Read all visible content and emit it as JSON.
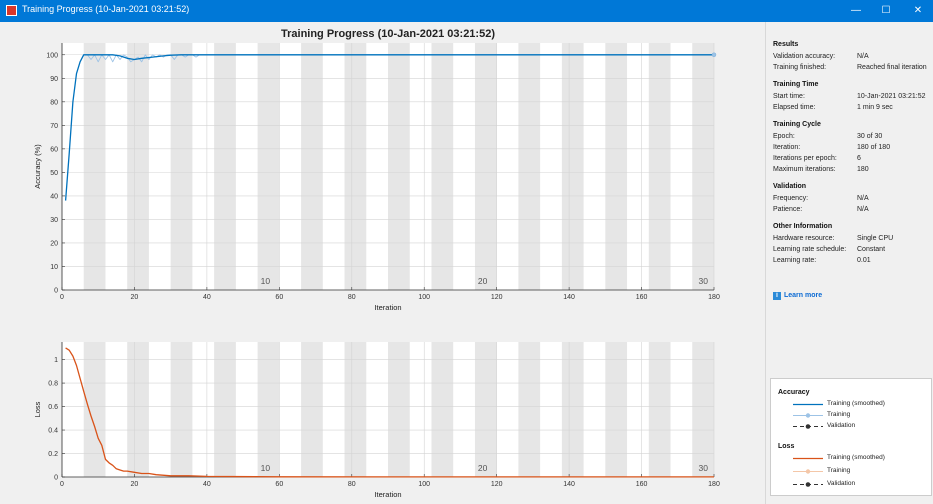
{
  "window": {
    "title": "Training Progress (10-Jan-2021 03:21:52)",
    "controls": {
      "minimize": "—",
      "maximize": "☐",
      "close": "✕"
    }
  },
  "plot_title": "Training Progress (10-Jan-2021 03:21:52)",
  "chart_data": [
    {
      "type": "line",
      "title": "Training Progress (10-Jan-2021 03:21:52)",
      "xlabel": "Iteration",
      "ylabel": "Accuracy (%)",
      "xlim": [
        0,
        180
      ],
      "ylim": [
        0,
        105
      ],
      "xticks": [
        0,
        20,
        40,
        60,
        80,
        100,
        120,
        140,
        160,
        180
      ],
      "yticks": [
        0,
        10,
        20,
        30,
        40,
        50,
        60,
        70,
        80,
        90,
        100
      ],
      "epoch_labels": [
        "10",
        "20",
        "30"
      ],
      "epoch_label_positions": [
        60,
        120,
        180
      ],
      "grid": true,
      "epoch_bands": {
        "iterations_per_epoch": 6,
        "shaded": "alternate"
      },
      "series": [
        {
          "name": "Training (smoothed)",
          "color": "#0072bd",
          "x": [
            1,
            2,
            3,
            4,
            5,
            6,
            7,
            8,
            10,
            12,
            14,
            16,
            18,
            20,
            22,
            25,
            28,
            30,
            33,
            36,
            40,
            60,
            100,
            140,
            180
          ],
          "y": [
            38,
            58,
            80,
            92,
            97,
            100,
            100,
            100,
            100,
            100,
            100,
            99.5,
            98.5,
            98,
            98.5,
            99,
            99.5,
            99.8,
            100,
            100,
            100,
            100,
            100,
            100,
            100
          ]
        },
        {
          "name": "Training",
          "color": "#9dc3e6",
          "x": [
            7,
            8,
            9,
            10,
            11,
            12,
            13,
            14,
            15,
            16,
            17,
            18,
            19,
            20,
            21,
            22,
            23,
            24,
            25,
            26,
            27,
            28,
            29,
            30,
            31,
            32,
            33,
            34,
            35,
            36,
            37,
            38,
            180
          ],
          "y": [
            100,
            98,
            100,
            97,
            100,
            98,
            100,
            97,
            100,
            98,
            100,
            99,
            97,
            98,
            99,
            97,
            100,
            98,
            100,
            99,
            100,
            99,
            100,
            100,
            98,
            100,
            100,
            99,
            100,
            100,
            99,
            100,
            100
          ]
        }
      ],
      "final_marker": {
        "x": 180,
        "y": 100
      }
    },
    {
      "type": "line",
      "xlabel": "Iteration",
      "ylabel": "Loss",
      "xlim": [
        0,
        180
      ],
      "ylim": [
        0,
        1.15
      ],
      "xticks": [
        0,
        20,
        40,
        60,
        80,
        100,
        120,
        140,
        160,
        180
      ],
      "yticks": [
        0,
        0.2,
        0.4,
        0.6,
        0.8,
        1
      ],
      "epoch_labels": [
        "10",
        "20",
        "30"
      ],
      "epoch_label_positions": [
        60,
        120,
        180
      ],
      "grid": true,
      "epoch_bands": {
        "iterations_per_epoch": 6,
        "shaded": "alternate"
      },
      "series": [
        {
          "name": "Training (smoothed)",
          "color": "#d95319",
          "x": [
            1,
            2,
            3,
            4,
            5,
            6,
            7,
            8,
            9,
            10,
            11,
            12,
            13,
            14,
            15,
            16,
            17,
            18,
            20,
            22,
            24,
            26,
            30,
            35,
            40,
            60,
            100,
            140,
            180
          ],
          "y": [
            1.1,
            1.08,
            1.03,
            0.95,
            0.84,
            0.73,
            0.62,
            0.52,
            0.43,
            0.33,
            0.27,
            0.15,
            0.12,
            0.1,
            0.07,
            0.06,
            0.05,
            0.05,
            0.04,
            0.03,
            0.03,
            0.02,
            0.01,
            0.01,
            0.005,
            0.002,
            0.001,
            0.001,
            0.001
          ]
        }
      ]
    }
  ],
  "panel": {
    "results": {
      "title": "Results",
      "rows": [
        {
          "label": "Validation accuracy:",
          "value": "N/A"
        },
        {
          "label": "Training finished:",
          "value": "Reached final iteration"
        }
      ]
    },
    "time": {
      "title": "Training Time",
      "rows": [
        {
          "label": "Start time:",
          "value": "10-Jan-2021 03:21:52"
        },
        {
          "label": "Elapsed time:",
          "value": "1 min 9 sec"
        }
      ]
    },
    "cycle": {
      "title": "Training Cycle",
      "rows": [
        {
          "label": "Epoch:",
          "value": "30 of 30"
        },
        {
          "label": "Iteration:",
          "value": "180 of 180"
        },
        {
          "label": "Iterations per epoch:",
          "value": "6"
        },
        {
          "label": "Maximum iterations:",
          "value": "180"
        }
      ]
    },
    "validation": {
      "title": "Validation",
      "rows": [
        {
          "label": "Frequency:",
          "value": "N/A"
        },
        {
          "label": "Patience:",
          "value": "N/A"
        }
      ]
    },
    "other": {
      "title": "Other Information",
      "rows": [
        {
          "label": "Hardware resource:",
          "value": "Single CPU"
        },
        {
          "label": "Learning rate schedule:",
          "value": "Constant"
        },
        {
          "label": "Learning rate:",
          "value": "0.01"
        }
      ]
    },
    "learn_more": "Learn more"
  },
  "legend": {
    "accuracy": {
      "title": "Accuracy",
      "items": [
        "Training (smoothed)",
        "Training",
        "Validation"
      ]
    },
    "loss": {
      "title": "Loss",
      "items": [
        "Training (smoothed)",
        "Training",
        "Validation"
      ]
    }
  },
  "colors": {
    "accuracy_smoothed": "#0072bd",
    "accuracy_raw": "#9dc3e6",
    "loss_smoothed": "#d95319",
    "loss_raw": "#f4c7a8",
    "validation": "#333333",
    "titlebar": "#0078d7"
  }
}
